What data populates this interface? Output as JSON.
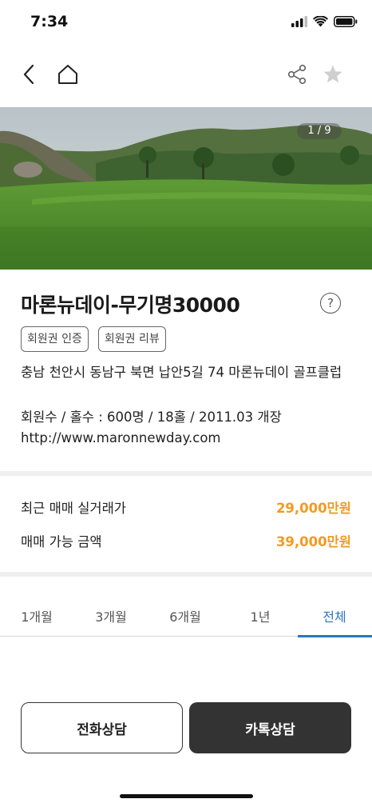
{
  "status": {
    "time": "7:34",
    "icons": [
      "signal-icon",
      "wifi-icon",
      "battery-icon"
    ]
  },
  "nav": {
    "icons": [
      "back-arrow-icon",
      "home-icon",
      "share-icon",
      "star-icon"
    ]
  },
  "gallery": {
    "counter": "1 / 9"
  },
  "club": {
    "title": "마론뉴데이-무기명30000",
    "help_symbol": "?",
    "badges": [
      "회원권 인증",
      "회원권 리뷰"
    ],
    "address": "충남 천안시 동남구 북면 납안5길 74 마론뉴데이 골프클럽",
    "stats": "회원수 / 홀수 : 600명 / 18홀 / 2011.03 개장",
    "website": "http://www.maronnewday.com"
  },
  "prices": [
    {
      "label": "최근 매매 실거래가",
      "value": "29,000만원"
    },
    {
      "label": "매매 가능 금액",
      "value": "39,000만원"
    }
  ],
  "tabs": {
    "items": [
      "1개월",
      "3개월",
      "6개월",
      "1년",
      "전체"
    ],
    "active": "전체"
  },
  "actions": {
    "call": "전화상담",
    "kakao": "카톡상담"
  },
  "colors": {
    "accent_price": "#f39a1f",
    "tab_active": "#2b76c0",
    "primary_button": "#333333"
  }
}
